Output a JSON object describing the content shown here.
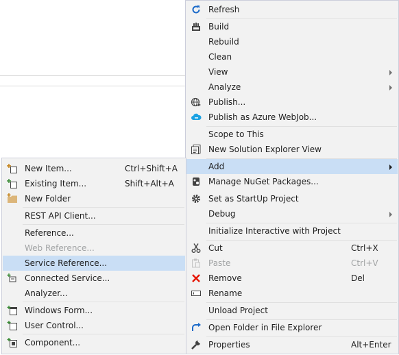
{
  "main_menu": {
    "items": [
      {
        "label": "Refresh",
        "icon": "refresh-icon"
      },
      {
        "label": "Build",
        "icon": "build-icon"
      },
      {
        "label": "Rebuild"
      },
      {
        "label": "Clean"
      },
      {
        "label": "View",
        "submenu": true
      },
      {
        "label": "Analyze",
        "submenu": true
      },
      {
        "label": "Publish...",
        "icon": "globe-icon"
      },
      {
        "label": "Publish as Azure WebJob...",
        "icon": "cloud-icon"
      },
      {
        "label": "Scope to This"
      },
      {
        "label": "New Solution Explorer View",
        "icon": "solution-explorer-icon"
      },
      {
        "label": "Add",
        "submenu": true,
        "highlighted": true
      },
      {
        "label": "Manage NuGet Packages...",
        "icon": "nuget-icon"
      },
      {
        "label": "Set as StartUp Project",
        "icon": "gear-icon"
      },
      {
        "label": "Debug",
        "submenu": true
      },
      {
        "label": "Initialize Interactive with Project"
      },
      {
        "label": "Cut",
        "icon": "scissors-icon",
        "shortcut": "Ctrl+X"
      },
      {
        "label": "Paste",
        "icon": "paste-icon",
        "shortcut": "Ctrl+V",
        "disabled": true
      },
      {
        "label": "Remove",
        "icon": "remove-icon",
        "shortcut": "Del"
      },
      {
        "label": "Rename",
        "icon": "rename-icon"
      },
      {
        "label": "Unload Project"
      },
      {
        "label": "Open Folder in File Explorer",
        "icon": "open-folder-icon"
      },
      {
        "label": "Properties",
        "icon": "wrench-icon",
        "shortcut": "Alt+Enter"
      }
    ]
  },
  "add_submenu": {
    "items": [
      {
        "label": "New Item...",
        "icon": "new-item-icon",
        "shortcut": "Ctrl+Shift+A"
      },
      {
        "label": "Existing Item...",
        "icon": "existing-item-icon",
        "shortcut": "Shift+Alt+A"
      },
      {
        "label": "New Folder",
        "icon": "new-folder-icon"
      },
      {
        "label": "REST API Client..."
      },
      {
        "label": "Reference..."
      },
      {
        "label": "Web Reference...",
        "disabled": true
      },
      {
        "label": "Service Reference...",
        "highlighted": true
      },
      {
        "label": "Connected Service...",
        "icon": "connected-service-icon"
      },
      {
        "label": "Analyzer..."
      },
      {
        "label": "Windows Form...",
        "icon": "windows-form-icon"
      },
      {
        "label": "User Control...",
        "icon": "user-control-icon"
      },
      {
        "label": "Component...",
        "icon": "component-icon"
      }
    ]
  },
  "colors": {
    "menu_bg": "#f2f2f2",
    "highlight": "#c9def5",
    "border": "#cccedb",
    "disabled_text": "#a2a4a5"
  }
}
